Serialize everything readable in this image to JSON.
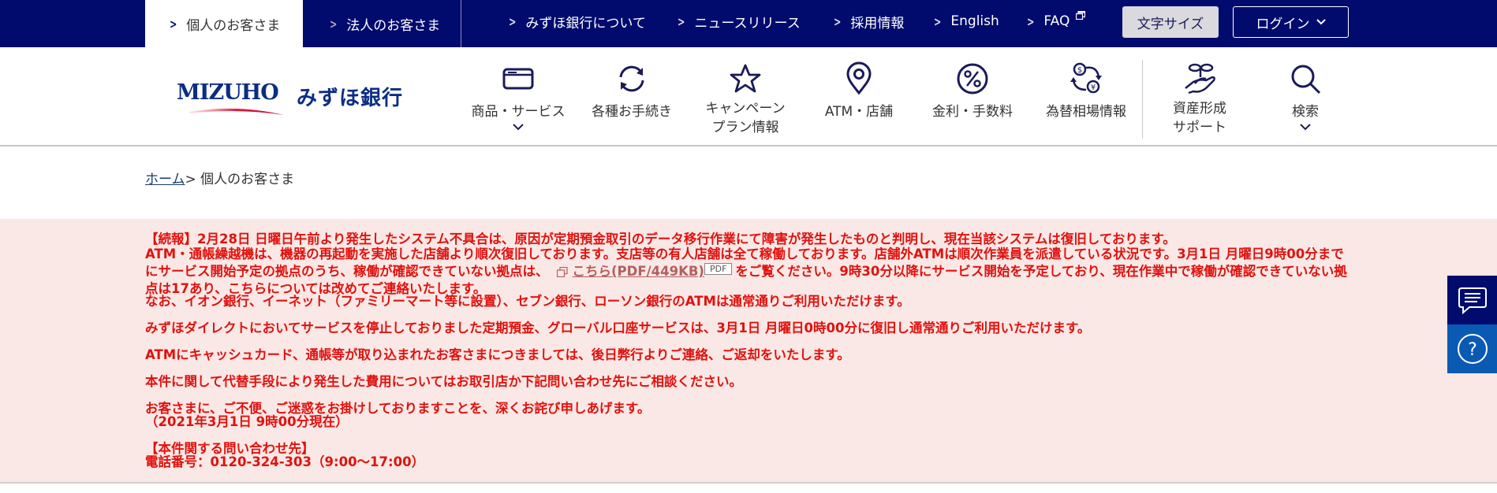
{
  "topbar": {
    "tabs": [
      {
        "label": "個人のお客さま",
        "active": true
      },
      {
        "label": "法人のお客さま",
        "active": false
      }
    ],
    "links": [
      {
        "label": "みずほ銀行について"
      },
      {
        "label": "ニュースリリース"
      },
      {
        "label": "採用情報"
      },
      {
        "label": "English"
      },
      {
        "label": "FAQ",
        "external": true
      }
    ],
    "font_size_button": "文字サイズ",
    "login_button": "ログイン"
  },
  "header": {
    "logo_en": "MIZUHO",
    "logo_jp": "みずほ銀行",
    "nav": [
      {
        "label": "商品・サービス",
        "icon": "card-icon",
        "has_dropdown": true
      },
      {
        "label": "各種お手続き",
        "icon": "refresh-icon",
        "has_dropdown": false
      },
      {
        "label_line1": "キャンペーン",
        "label_line2": "プラン情報",
        "icon": "star-icon",
        "has_dropdown": false
      },
      {
        "label": "ATM・店舗",
        "icon": "map-pin-icon",
        "has_dropdown": false
      },
      {
        "label": "金利・手数料",
        "icon": "percent-icon",
        "has_dropdown": false
      },
      {
        "label": "為替相場情報",
        "icon": "currency-exchange-icon",
        "has_dropdown": false
      },
      {
        "label_line1": "資産形成",
        "label_line2": "サポート",
        "icon": "plant-hand-icon",
        "has_dropdown": false
      },
      {
        "label": "検索",
        "icon": "search-icon",
        "has_dropdown": true
      }
    ]
  },
  "breadcrumb": {
    "home": "ホーム",
    "separator": ">",
    "current": " 個人のお客さま"
  },
  "notice": {
    "colors": {
      "text": "#e0120f",
      "background": "#fae8e6"
    },
    "line1": "【続報】2月28日 日曜日午前より発生したシステム不具合は、原因が定期預金取引のデータ移行作業にて障害が発生したものと判明し、現在当該システムは復旧しております。",
    "para2_before_link": "ATM・通帳繰越機は、機器の再起動を実施した店舗より順次復旧しております。支店等の有人店舗は全て稼働しております。店舗外ATMは順次作業員を派遣している状況です。3月1日 月曜日9時00分までにサービス開始予定の拠点のうち、稼働が確認できていない拠点は、",
    "pdf_link": "こちら(PDF/449KB)",
    "pdf_badge": "PDF",
    "para2_after_link": "をご覧ください。9時30分以降にサービス開始を予定しており、現在作業中で稼働が確認できていない拠点は17あり、こちらについては改めてご連絡いたします。",
    "line_other_atm": "なお、イオン銀行、イーネット（ファミリーマート等に設置）、セブン銀行、ローソン銀行のATMは通常通りご利用いただけます。",
    "line_direct": "みずほダイレクトにおいてサービスを停止しておりました定期預金、グローバル口座サービスは、3月1日 月曜日0時00分に復旧し通常通りご利用いただけます。",
    "line_card": "ATMにキャッシュカード、通帳等が取り込まれたお客さまにつきましては、後日弊行よりご連絡、ご返却をいたします。",
    "line_cost": "本件に関して代替手段により発生した費用についてはお取引店か下記問い合わせ先にご相談ください。",
    "line_apology": "お客さまに、ご不便、ご迷惑をお掛けしておりますことを、深くお詫び申しあげます。",
    "line_timestamp": "（2021年3月1日 9時00分現在）",
    "contact_heading": "【本件関する問い合わせ先】",
    "contact_phone": "電話番号：0120-324-303（9:00～17:00）"
  },
  "side": {
    "chat_icon": "chat-icon",
    "help_icon": "help-icon"
  }
}
